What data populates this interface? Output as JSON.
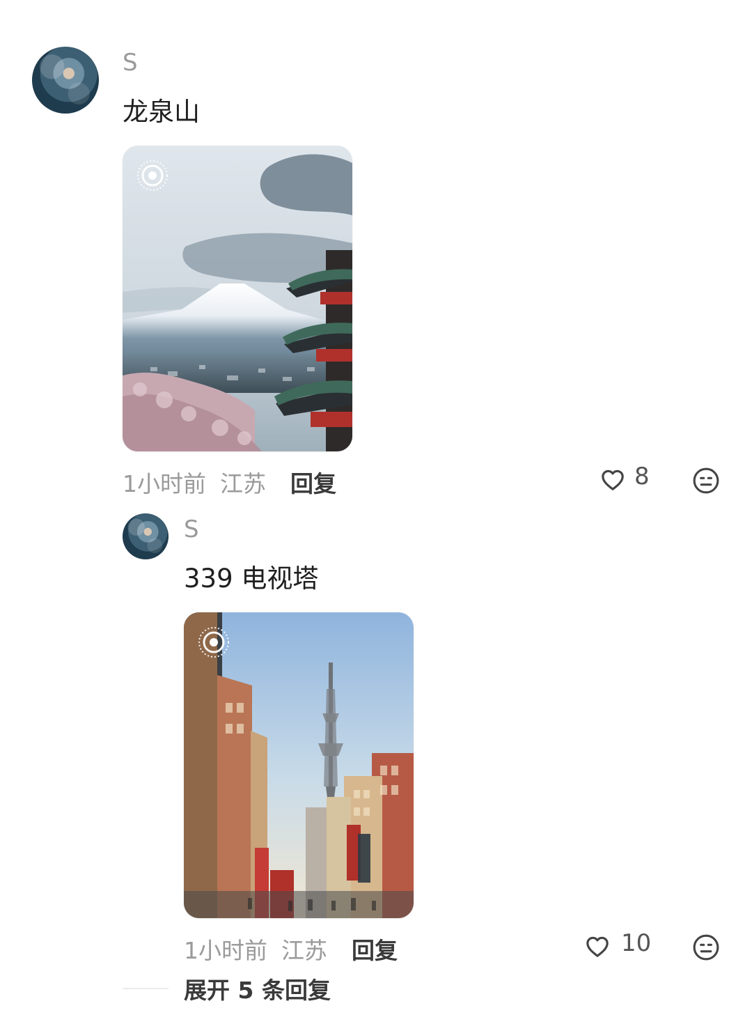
{
  "comments": [
    {
      "username": "S",
      "text": "龙泉山",
      "time": "1小时前",
      "location": "江苏",
      "reply_label": "回复",
      "likes": "8",
      "photo_alt": "Mount Fuji with pagoda and cherry blossoms"
    },
    {
      "username": "S",
      "text": "339 电视塔",
      "time": "1小时前",
      "location": "江苏",
      "reply_label": "回复",
      "likes": "10",
      "photo_alt": "Street view with tall broadcast tower"
    }
  ],
  "expand_replies": "展开 5 条回复",
  "icons": {
    "heart": "heart-icon",
    "emoji": "neutral-face-icon",
    "live": "live-photo-icon"
  },
  "colors": {
    "meta": "#9a9a9a",
    "text": "#1f1f1f"
  }
}
